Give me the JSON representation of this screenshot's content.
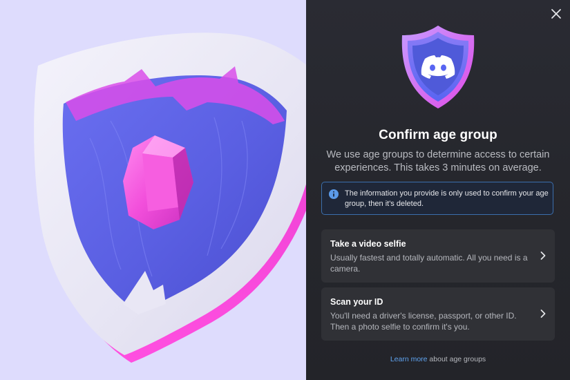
{
  "modal": {
    "title": "Confirm age group",
    "subtitle": "We use age groups to determine access to certain experiences. This takes 3 minutes on average.",
    "info_text": "The information you provide is only used to confirm your age group, then it's deleted.",
    "options": [
      {
        "title": "Take a video selfie",
        "description": "Usually fastest and totally automatic. All you need is a camera."
      },
      {
        "title": "Scan your ID",
        "description": "You'll need a driver's license, passport, or other ID. Then a photo selfie to confirm it's you."
      }
    ],
    "footer_link": "Learn more",
    "footer_text": " about age groups"
  },
  "icons": [
    "close-icon",
    "discord-shield-logo",
    "info-icon",
    "chevron-right-icon",
    "shield-gem-illustration"
  ],
  "colors": {
    "panel_bg": "#26272d",
    "accent_link": "#5fa3f0",
    "info_border": "#3b6fae",
    "shield_purple": "#5b5fe0",
    "gem_pink": "#f14ed6",
    "left_bg": "#dedcfd"
  }
}
